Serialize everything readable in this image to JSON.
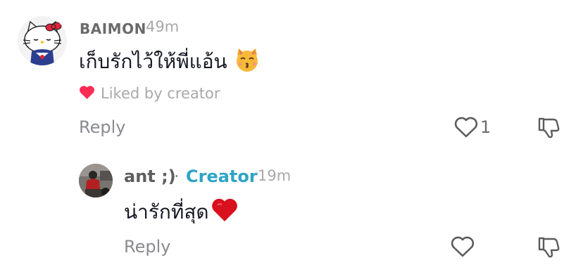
{
  "comments": [
    {
      "username": "BAIMON",
      "time": "49m",
      "text": "เก็บรักไว้ให้พี่แอ้น",
      "emoji_icon": "kissing-cat-emoji",
      "liked_by": "Liked by creator",
      "reply_label": "Reply",
      "like_count": "1",
      "accent_heart": "#fe2c55"
    },
    {
      "username": "ant ;)",
      "separator": "·",
      "badge": "Creator",
      "time": "19m",
      "text": "น่ารักที่สุด",
      "emoji_icon": "red-heart-emoji",
      "reply_label": "Reply",
      "badge_color": "#2fa4c5"
    }
  ]
}
